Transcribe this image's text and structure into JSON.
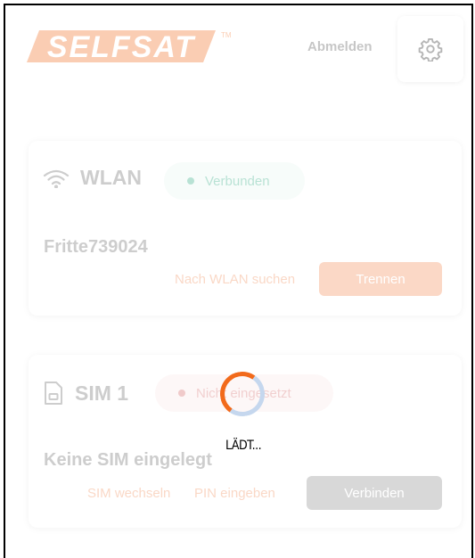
{
  "header": {
    "logo_text": "SELFSAT",
    "logout_label": "Abmelden",
    "settings_icon": "gear-icon"
  },
  "wlan": {
    "title": "WLAN",
    "icon": "wifi-icon",
    "status": "Verbunden",
    "network_name": "Fritte739024",
    "search_label": "Nach WLAN suchen",
    "disconnect_label": "Trennen"
  },
  "sim": {
    "title": "SIM 1",
    "icon": "sim-card-icon",
    "status": "Nicht eingesetzt",
    "info": "Keine SIM eingelegt",
    "switch_label": "SIM wechseln",
    "pin_label": "PIN eingeben",
    "connect_label": "Verbinden"
  },
  "loading": {
    "text": "LÄDT..."
  },
  "colors": {
    "brand_orange": "#f48a55",
    "success_green": "#2aa880",
    "error_red": "#d46060",
    "disabled_grey": "#8c8c8c"
  }
}
